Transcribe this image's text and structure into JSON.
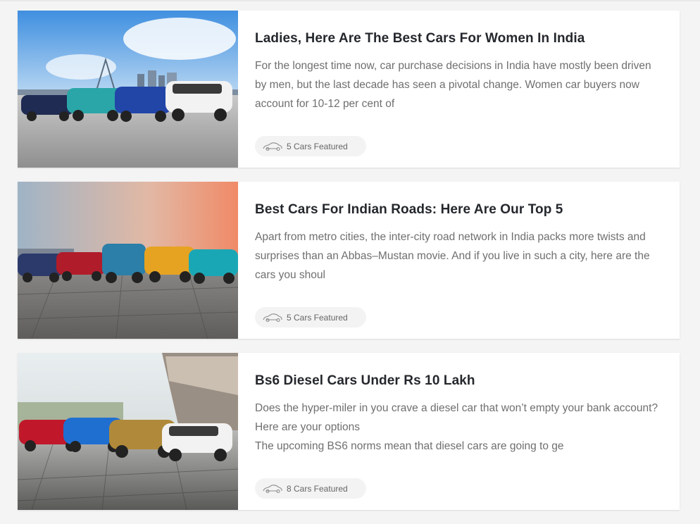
{
  "articles": [
    {
      "title": "Ladies, Here Are The Best Cars For Women In India",
      "excerpt": "For the longest time now, car purchase decisions in India have mostly been driven by men, but the last decade has seen a pivotal change. Women car buyers now account for 10-12 per cent of",
      "badge": "5 Cars Featured",
      "image": "cars-city-skyline-photo",
      "colors": [
        "#1f2b52",
        "#2aa6a8",
        "#2245a8",
        "#f2f2f2"
      ]
    },
    {
      "title": "Best Cars For Indian Roads: Here Are Our Top 5",
      "excerpt": "Apart from metro cities, the inter-city road network in India packs more twists and surprises than an Abbas–Mustan movie. And if you live in such a city, here are the cars you shoul",
      "badge": "5 Cars Featured",
      "image": "cars-sunset-plaza-photo",
      "colors": [
        "#2b3a6b",
        "#b01c2a",
        "#2b7fa8",
        "#e6a321",
        "#1aa7b5"
      ]
    },
    {
      "title": "Bs6 Diesel Cars Under Rs 10 Lakh",
      "excerpt": "Does the hyper-miler in you crave a diesel car that won’t empty your bank account? Here are your options\nThe upcoming BS6 norms mean that diesel cars are going to ge",
      "badge": "8 Cars Featured",
      "image": "cars-modern-building-photo",
      "colors": [
        "#c0182a",
        "#1f6fd1",
        "#b08a3a",
        "#f2f2f2"
      ]
    }
  ]
}
